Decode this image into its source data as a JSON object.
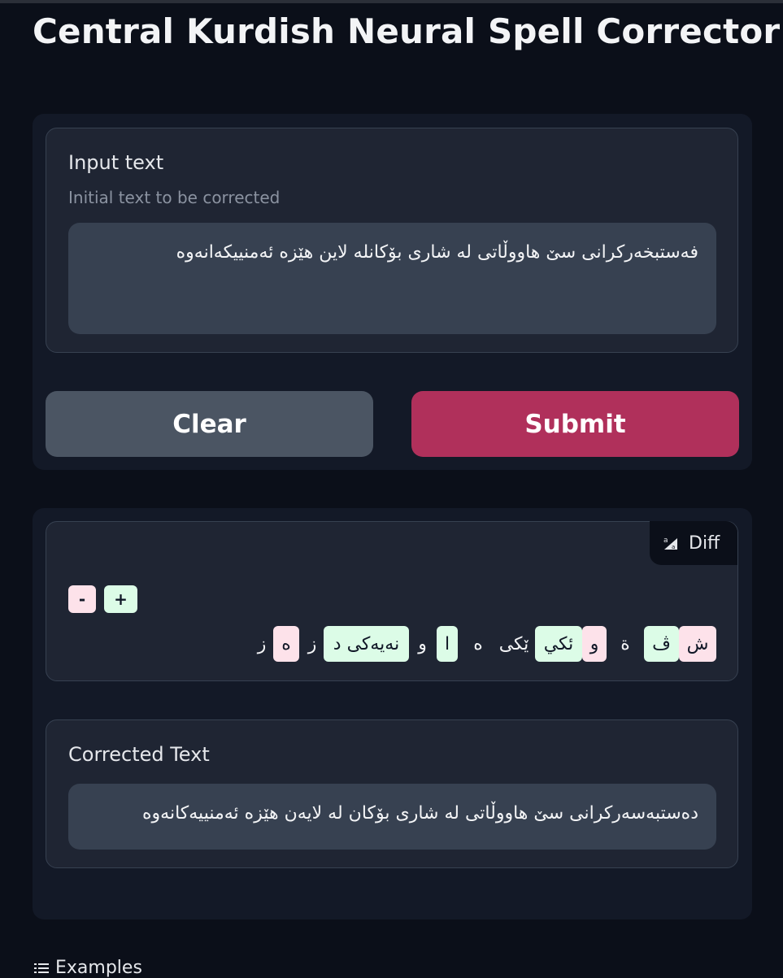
{
  "app": {
    "title": "Central Kurdish Neural Spell Corrector"
  },
  "input": {
    "label": "Input text",
    "info": "Initial text to be corrected",
    "value": "فەستبخەرکرانی سێ هاووڵاتی لە شاری بۆکانلە لاین هێزە ئەمنییکەانەوە"
  },
  "buttons": {
    "clear_label": "Clear",
    "submit_label": "Submit"
  },
  "diff": {
    "label": "Diff",
    "legend_minus": "-",
    "legend_plus": "+",
    "tokens": [
      {
        "text": "ش",
        "type": "del"
      },
      {
        "text": "ڤ",
        "type": "ins"
      },
      {
        "text": "ة",
        "type": "plain"
      },
      {
        "text": "و",
        "type": "del"
      },
      {
        "text": "ئكي",
        "type": "ins"
      },
      {
        "text": "ێکی",
        "type": "plain"
      },
      {
        "text": "ه",
        "type": "plain"
      },
      {
        "text": "ا",
        "type": "ins"
      },
      {
        "text": "و",
        "type": "plain"
      },
      {
        "text": "نەیەکی د",
        "type": "ins"
      },
      {
        "text": "ز",
        "type": "plain"
      },
      {
        "text": "ه",
        "type": "del"
      },
      {
        "text": "ز",
        "type": "plain"
      }
    ]
  },
  "corrected": {
    "label": "Corrected Text",
    "value": "دەستبەسەرکرانی سێ هاووڵاتی لە شاری بۆکان لە لایەن هێزە ئەمنییەکانەوە"
  },
  "examples": {
    "label": "Examples"
  },
  "colors": {
    "background": "#0b0f19",
    "panel": "#131927",
    "submit": "#b0305b",
    "clear": "#4b5563",
    "diff_deleted": "#fde2ea",
    "diff_inserted": "#dcfce7"
  }
}
